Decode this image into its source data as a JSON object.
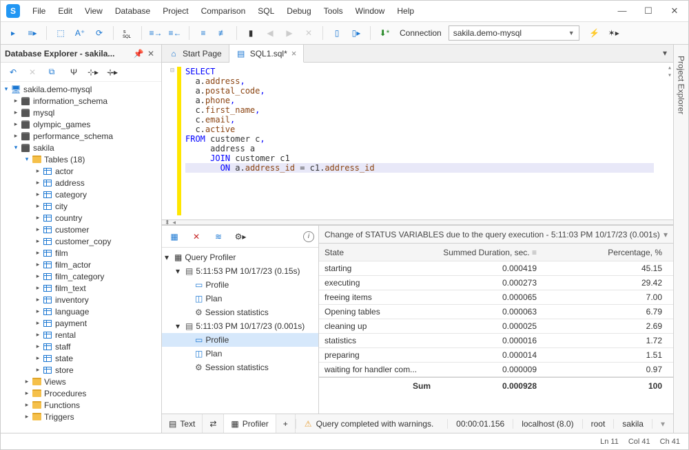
{
  "menu": [
    "File",
    "Edit",
    "View",
    "Database",
    "Project",
    "Comparison",
    "SQL",
    "Debug",
    "Tools",
    "Window",
    "Help"
  ],
  "connection": {
    "label": "Connection",
    "value": "sakila.demo-mysql"
  },
  "explorer": {
    "title": "Database Explorer - sakila...",
    "server": "sakila.demo-mysql",
    "dbs": [
      "information_schema",
      "mysql",
      "olympic_games",
      "performance_schema"
    ],
    "db_open": "sakila",
    "tables_label": "Tables (18)",
    "tables": [
      "actor",
      "address",
      "category",
      "city",
      "country",
      "customer",
      "customer_copy",
      "film",
      "film_actor",
      "film_category",
      "film_text",
      "inventory",
      "language",
      "payment",
      "rental",
      "staff",
      "state",
      "store"
    ],
    "folders": [
      "Views",
      "Procedures",
      "Functions",
      "Triggers"
    ]
  },
  "tabs": {
    "start": "Start Page",
    "sql": "SQL1.sql*"
  },
  "sql": {
    "l1": "SELECT",
    "l2a": "  a.",
    "l2b": "address",
    "l2c": ",",
    "l3a": "  a.",
    "l3b": "postal_code",
    "l3c": ",",
    "l4a": "  a.",
    "l4b": "phone",
    "l4c": ",",
    "l5a": "  c.",
    "l5b": "first_name",
    "l5c": ",",
    "l6a": "  c.",
    "l6b": "email",
    "l6c": ",",
    "l7a": "  c.",
    "l7b": "active",
    "l8a": "FROM",
    "l8b": " customer c",
    "l8c": ",",
    "l9": "     address a",
    "l10a": "     ",
    "l10b": "JOIN",
    "l10c": " customer c1",
    "l11a": "       ",
    "l11b": "ON",
    "l11c": " a.",
    "l11d": "address_id",
    "l11e": " = c1.",
    "l11f": "address_id"
  },
  "profiler": {
    "root": "Query Profiler",
    "run1": "5:11:53 PM 10/17/23 (0.15s)",
    "run2": "5:11:03 PM 10/17/23 (0.001s)",
    "items": [
      "Profile",
      "Plan",
      "Session statistics"
    ]
  },
  "grid": {
    "title": "Change of STATUS VARIABLES due to the query execution - 5:11:03 PM 10/17/23 (0.001s)",
    "headers": [
      "State",
      "Summed Duration, sec.",
      "Percentage, %"
    ],
    "rows": [
      {
        "s": "starting",
        "d": "0.000419",
        "p": "45.15"
      },
      {
        "s": "executing",
        "d": "0.000273",
        "p": "29.42"
      },
      {
        "s": "freeing items",
        "d": "0.000065",
        "p": "7.00"
      },
      {
        "s": "Opening tables",
        "d": "0.000063",
        "p": "6.79"
      },
      {
        "s": "cleaning up",
        "d": "0.000025",
        "p": "2.69"
      },
      {
        "s": "statistics",
        "d": "0.000016",
        "p": "1.72"
      },
      {
        "s": "preparing",
        "d": "0.000014",
        "p": "1.51"
      },
      {
        "s": "waiting for handler com...",
        "d": "0.000009",
        "p": "0.97"
      }
    ],
    "sum_label": "Sum",
    "sum_d": "0.000928",
    "sum_p": "100"
  },
  "bottom_tabs": {
    "text": "Text",
    "profiler": "Profiler"
  },
  "status": {
    "warn": "Query completed with warnings.",
    "time": "00:00:01.156",
    "host": "localhost (8.0)",
    "user": "root",
    "db": "sakila"
  },
  "statusbar": {
    "ln": "Ln 11",
    "col": "Col 41",
    "ch": "Ch 41"
  },
  "vtab": "Project Explorer"
}
